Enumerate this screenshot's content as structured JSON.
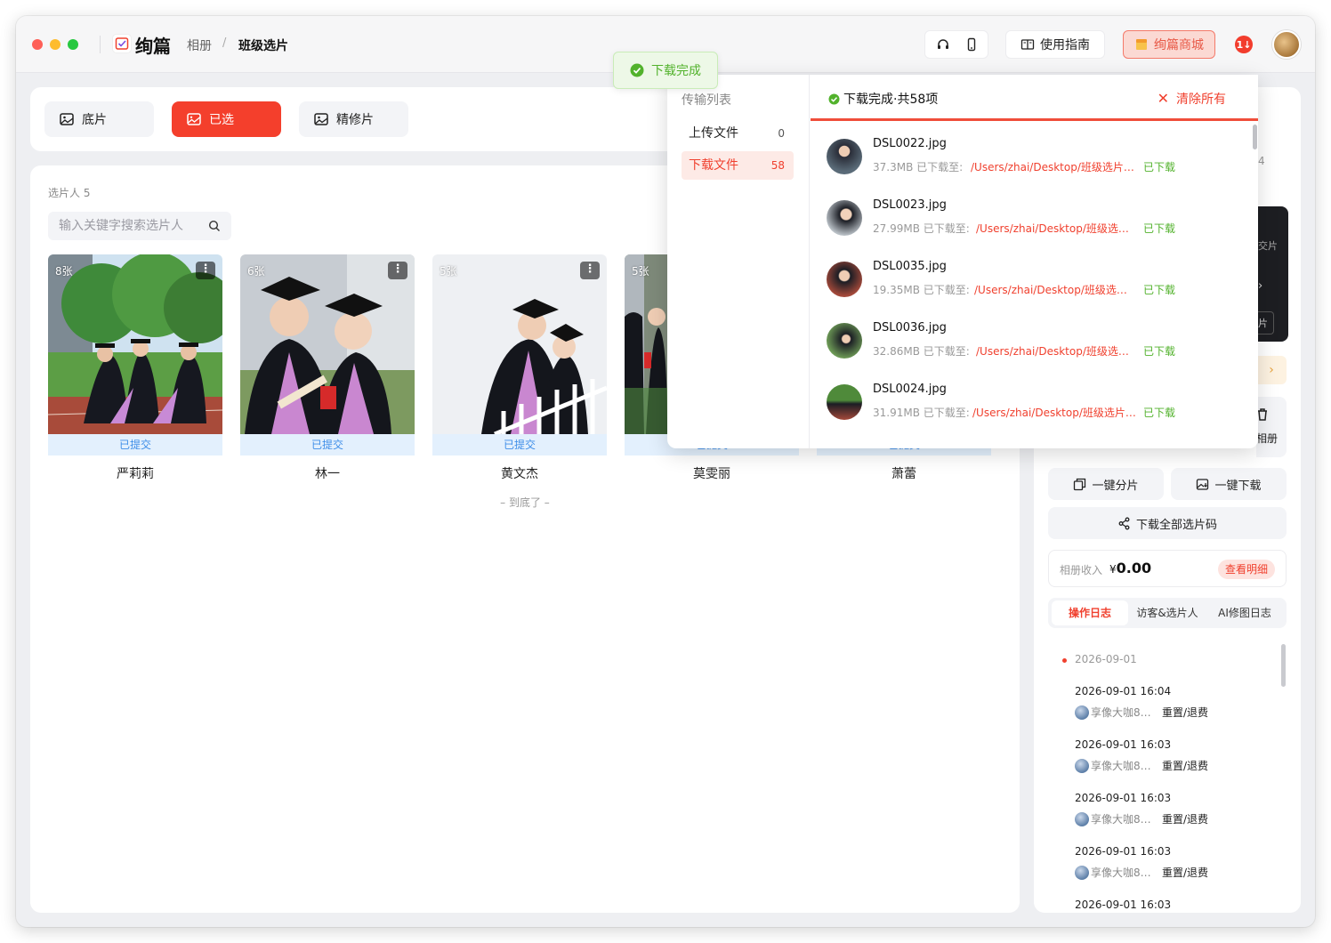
{
  "window": {
    "logo_text": "绚篇",
    "breadcrumb": [
      "相册",
      "班级选片"
    ],
    "guide_label": "使用指南",
    "mall_label": "绚篇商城",
    "notif_badge": "1↓"
  },
  "tabs": [
    {
      "label": "底片",
      "active": false
    },
    {
      "label": "已选",
      "active": true
    },
    {
      "label": "精修片",
      "active": false
    }
  ],
  "main": {
    "pickers_label": "选片人 5",
    "search_placeholder": "输入关键字搜索选片人",
    "cards": [
      {
        "count": "8张",
        "status": "已提交",
        "name": "严莉莉"
      },
      {
        "count": "6张",
        "status": "已提交",
        "name": "林一"
      },
      {
        "count": "5张",
        "status": "已提交",
        "name": "黄文杰"
      },
      {
        "count": "5张",
        "status": "已提交",
        "name": "莫雯丽"
      },
      {
        "count": "",
        "status": "已提交",
        "name": "萧蕾"
      }
    ],
    "bottom_note": "– 到底了 –"
  },
  "toast": {
    "text": "下载完成"
  },
  "transfer": {
    "title": "传输列表",
    "nav": [
      {
        "label": "上传文件",
        "count": "0",
        "active": false
      },
      {
        "label": "下载文件",
        "count": "58",
        "active": true
      }
    ],
    "header": "下载完成·共58项",
    "clear_label": "清除所有",
    "files": [
      {
        "name": "DSL0022.jpg",
        "meta": "37.3MB 已下载至:",
        "path": "/Users/zhai/Desktop/班级选片…",
        "status": "已下载"
      },
      {
        "name": "DSL0023.jpg",
        "meta": "27.99MB 已下载至:",
        "path": "/Users/zhai/Desktop/班级选…",
        "status": "已下载"
      },
      {
        "name": "DSL0035.jpg",
        "meta": "19.35MB 已下载至:",
        "path": "/Users/zhai/Desktop/班级选…",
        "status": "已下载"
      },
      {
        "name": "DSL0036.jpg",
        "meta": "32.86MB 已下载至:",
        "path": "/Users/zhai/Desktop/班级选…",
        "status": "已下载"
      },
      {
        "name": "DSL0024.jpg",
        "meta": "31.91MB 已下载至:",
        "path": "/Users/zhai/Desktop/班级选片…",
        "status": "已下载"
      }
    ]
  },
  "sidebar": {
    "peek_text_1": "4",
    "peek_text_2": "交片",
    "peek_text_3": "片",
    "album_label": "相册",
    "split_label": "一键分片",
    "download_label": "一键下载",
    "download_codes_label": "下载全部选片码",
    "income_label": "相册收入",
    "income_currency": "¥",
    "income_value": "0.00",
    "income_detail": "查看明细",
    "log_tabs": [
      "操作日志",
      "访客&选片人",
      "AI修图日志"
    ],
    "log_date": "2026-09-01",
    "logs": [
      {
        "time": "2026-09-01 16:04",
        "user": "享像大咖8…",
        "action": "重置/退费"
      },
      {
        "time": "2026-09-01 16:03",
        "user": "享像大咖8…",
        "action": "重置/退费"
      },
      {
        "time": "2026-09-01 16:03",
        "user": "享像大咖8…",
        "action": "重置/退费"
      },
      {
        "time": "2026-09-01 16:03",
        "user": "享像大咖8…",
        "action": "重置/退费"
      },
      {
        "time": "2026-09-01 16:03",
        "user": "",
        "action": ""
      }
    ]
  },
  "colors": {
    "accent": "#f43f2c",
    "success": "#52b22c",
    "info": "#3f8ee8"
  }
}
